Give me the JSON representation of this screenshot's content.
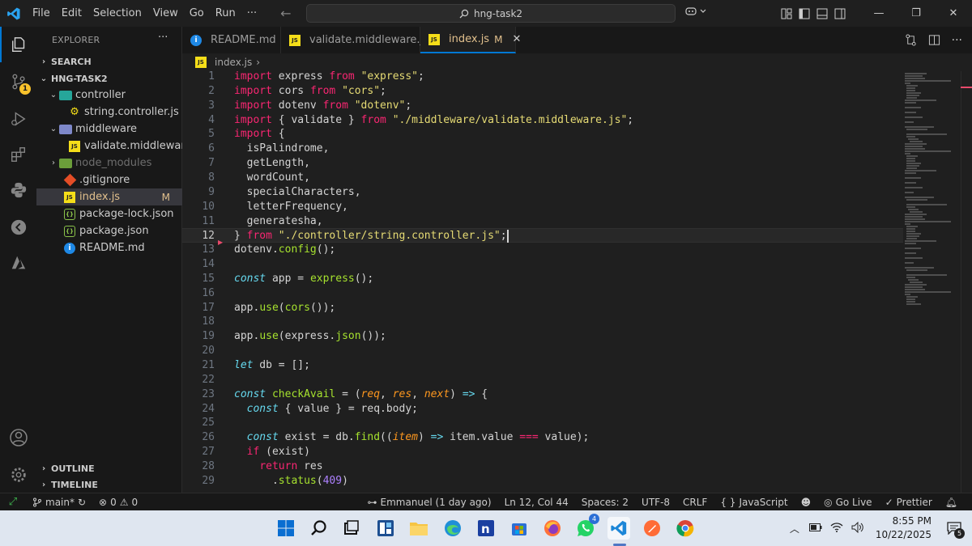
{
  "titlebar": {
    "menu": [
      "File",
      "Edit",
      "Selection",
      "View",
      "Go",
      "Run",
      "···"
    ],
    "search": "hng-task2"
  },
  "activity": {
    "source_control_badge": "1"
  },
  "sidebar": {
    "title": "EXPLORER",
    "more": "···",
    "search_section": "SEARCH",
    "project": "HNG-TASK2",
    "outline": "OUTLINE",
    "timeline": "TIMELINE",
    "tree": [
      {
        "label": "controller",
        "kind": "folder-open"
      },
      {
        "label": "string.controller.js",
        "kind": "gear"
      },
      {
        "label": "middleware",
        "kind": "folder-open"
      },
      {
        "label": "validate.middleware.js",
        "kind": "js"
      },
      {
        "label": "node_modules",
        "kind": "folder-closed"
      },
      {
        "label": ".gitignore",
        "kind": "git"
      },
      {
        "label": "index.js",
        "kind": "js",
        "modified": "M"
      },
      {
        "label": "package-lock.json",
        "kind": "json"
      },
      {
        "label": "package.json",
        "kind": "json"
      },
      {
        "label": "README.md",
        "kind": "readme"
      }
    ]
  },
  "tabs": [
    {
      "label": "README.md",
      "icon": "info-icon"
    },
    {
      "label": "validate.middleware.js",
      "icon": "js-icon"
    },
    {
      "label": "index.js",
      "icon": "js-icon",
      "modified": "M",
      "close": "✕"
    }
  ],
  "breadcrumb": {
    "file": "index.js",
    "sep": "›"
  },
  "editor": {
    "current_line": 12,
    "lines": [
      [
        [
          "kw",
          "import"
        ],
        [
          "",
          " express "
        ],
        [
          "kw",
          "from"
        ],
        [
          "",
          " "
        ],
        [
          "str",
          "\"express\""
        ],
        [
          "",
          ";"
        ]
      ],
      [
        [
          "kw",
          "import"
        ],
        [
          "",
          " cors "
        ],
        [
          "kw",
          "from"
        ],
        [
          "",
          " "
        ],
        [
          "str",
          "\"cors\""
        ],
        [
          "",
          ";"
        ]
      ],
      [
        [
          "kw",
          "import"
        ],
        [
          "",
          " dotenv "
        ],
        [
          "kw",
          "from"
        ],
        [
          "",
          " "
        ],
        [
          "str",
          "\"dotenv\""
        ],
        [
          "",
          ";"
        ]
      ],
      [
        [
          "kw",
          "import"
        ],
        [
          "",
          " { validate } "
        ],
        [
          "kw",
          "from"
        ],
        [
          "",
          " "
        ],
        [
          "str",
          "\"./middleware/validate.middleware.js\""
        ],
        [
          "",
          ";"
        ]
      ],
      [
        [
          "kw",
          "import"
        ],
        [
          "",
          " {"
        ]
      ],
      [
        [
          "",
          "  isPalindrome,"
        ]
      ],
      [
        [
          "",
          "  getLength,"
        ]
      ],
      [
        [
          "",
          "  wordCount,"
        ]
      ],
      [
        [
          "",
          "  specialCharacters,"
        ]
      ],
      [
        [
          "",
          "  letterFrequency,"
        ]
      ],
      [
        [
          "",
          "  generatesha,"
        ]
      ],
      [
        [
          "",
          "} "
        ],
        [
          "kw",
          "from"
        ],
        [
          "",
          " "
        ],
        [
          "str",
          "\"./controller/string.controller.js\""
        ],
        [
          "",
          ";"
        ]
      ],
      [
        [
          "",
          "dotenv."
        ],
        [
          "fn",
          "config"
        ],
        [
          "",
          "();"
        ]
      ],
      [],
      [
        [
          "kwi",
          "const"
        ],
        [
          "",
          " app = "
        ],
        [
          "fn",
          "express"
        ],
        [
          "",
          "();"
        ]
      ],
      [],
      [
        [
          "",
          "app."
        ],
        [
          "fn",
          "use"
        ],
        [
          "",
          "("
        ],
        [
          "fn",
          "cors"
        ],
        [
          "",
          "());"
        ]
      ],
      [],
      [
        [
          "",
          "app."
        ],
        [
          "fn",
          "use"
        ],
        [
          "",
          "(express."
        ],
        [
          "fn",
          "json"
        ],
        [
          "",
          "());"
        ]
      ],
      [],
      [
        [
          "kwi",
          "let"
        ],
        [
          "",
          " db = [];"
        ]
      ],
      [],
      [
        [
          "kwi",
          "const"
        ],
        [
          "",
          " "
        ],
        [
          "fn",
          "checkAvail"
        ],
        [
          "",
          " = ("
        ],
        [
          "prm",
          "req"
        ],
        [
          "",
          ", "
        ],
        [
          "prm",
          "res"
        ],
        [
          "",
          ", "
        ],
        [
          "prm",
          "next"
        ],
        [
          "",
          ") "
        ],
        [
          "kwi",
          "=>"
        ],
        [
          "",
          " {"
        ]
      ],
      [
        [
          "",
          "  "
        ],
        [
          "kwi",
          "const"
        ],
        [
          "",
          " { value } = req.body;"
        ]
      ],
      [],
      [
        [
          "",
          "  "
        ],
        [
          "kwi",
          "const"
        ],
        [
          "",
          " exist = db."
        ],
        [
          "fn",
          "find"
        ],
        [
          "",
          "(("
        ],
        [
          "prm",
          "item"
        ],
        [
          "",
          ") "
        ],
        [
          "kwi",
          "=>"
        ],
        [
          "",
          " item.value "
        ],
        [
          "kw",
          "==="
        ],
        [
          "",
          " value);"
        ]
      ],
      [
        [
          "",
          "  "
        ],
        [
          "kw",
          "if"
        ],
        [
          "",
          " (exist)"
        ]
      ],
      [
        [
          "",
          "    "
        ],
        [
          "kw",
          "return"
        ],
        [
          "",
          " res"
        ]
      ],
      [
        [
          "",
          "      ."
        ],
        [
          "fn",
          "status"
        ],
        [
          "",
          "("
        ],
        [
          "num",
          "409"
        ],
        [
          "",
          ")"
        ]
      ]
    ]
  },
  "statusbar": {
    "branch": "main*",
    "sync": "↻",
    "errors": "0",
    "warnings": "0",
    "blame": "Emmanuel (1 day ago)",
    "position": "Ln 12, Col 44",
    "spaces": "Spaces: 2",
    "encoding": "UTF-8",
    "eol": "CRLF",
    "language": "JavaScript",
    "golive": "Go Live",
    "prettier": "Prettier"
  },
  "taskbar": {
    "whatsapp_badge": "4",
    "time": "8:55 PM",
    "date": "10/22/2025",
    "notif_count": "5"
  },
  "colors": {
    "accent": "#0078d4",
    "modified": "#e2c08d",
    "keyword": "#f92672",
    "string": "#e6db74",
    "function": "#a6e22e"
  }
}
